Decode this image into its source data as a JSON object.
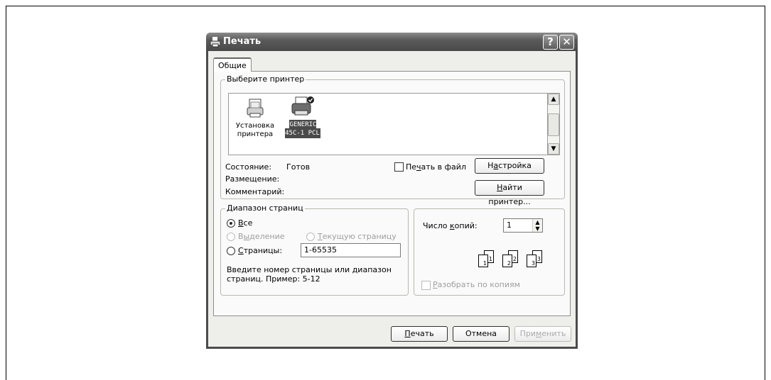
{
  "dialog": {
    "title": "Печать",
    "icon": "printer-icon",
    "help_label": "?",
    "close_label": "✕"
  },
  "tabs": [
    {
      "label": "Общие",
      "active": true
    }
  ],
  "printer_group": {
    "legend": "Выберите принтер",
    "printers": [
      {
        "line1": "Установка",
        "line2": "принтера",
        "icon": "add-printer-icon",
        "selected": false
      },
      {
        "line1": "GENERIC",
        "line2": "45C-1 PCL",
        "icon": "printer-icon",
        "selected": true,
        "default": true
      }
    ],
    "status_label": "Состояние:",
    "status_value": "Готов",
    "location_label": "Размещение:",
    "comment_label": "Комментарий:",
    "print_to_file_pre": "Пе",
    "print_to_file_u": "ч",
    "print_to_file_post": "ать в файл",
    "settings_pre": "Н",
    "settings_u": "а",
    "settings_post": "стройка",
    "find_printer_u": "Н",
    "find_printer_post": "айти принтер..."
  },
  "range_group": {
    "legend": "Диапазон страниц",
    "all_u": "В",
    "all_post": "се",
    "selection_pre": "В",
    "selection_u": "ы",
    "selection_post": "деление",
    "current_u": "Т",
    "current_post": "екущую страницу",
    "pages_u": "С",
    "pages_post": "траницы:",
    "pages_value": "1-65535",
    "hint_line1": "Введите номер страницы или диапазон",
    "hint_line2": "страниц.  Пример: 5-12",
    "selected": "all"
  },
  "copies_group": {
    "count_pre": "Число ",
    "count_u": "к",
    "count_post": "опий:",
    "count_value": "1",
    "collate_u": "Р",
    "collate_post": "азобрать по копиям",
    "collate_checked": false,
    "collate_enabled": false,
    "page_labels": [
      "1",
      "1",
      "2",
      "2",
      "3",
      "3"
    ]
  },
  "buttons": {
    "print_u": "П",
    "print_post": "ечать",
    "cancel": "Отмена",
    "apply_pre": "При",
    "apply_u": "м",
    "apply_post": "енить"
  }
}
